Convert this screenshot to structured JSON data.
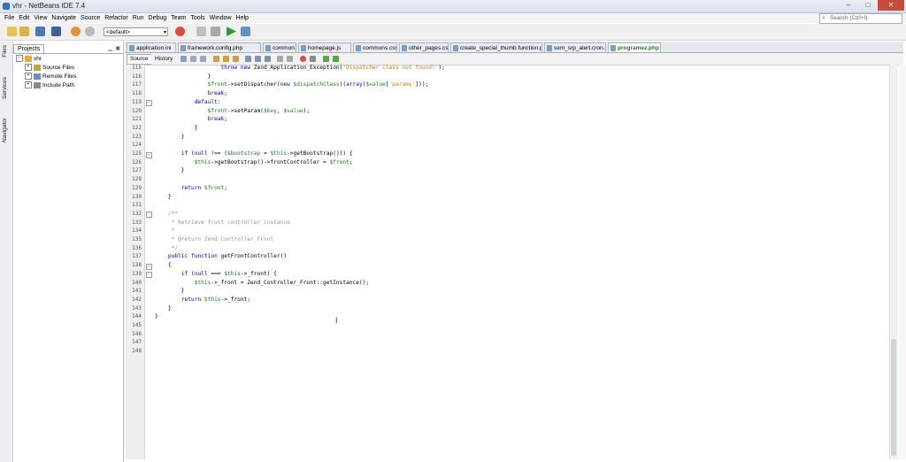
{
  "window": {
    "title": "vhr - NetBeans IDE 7.4",
    "min": "–",
    "max": "□",
    "close": "✕"
  },
  "menu": [
    "File",
    "Edit",
    "View",
    "Navigate",
    "Source",
    "Refactor",
    "Run",
    "Debug",
    "Team",
    "Tools",
    "Window",
    "Help"
  ],
  "search": {
    "placeholder": "Search (Ctrl+I)",
    "icon": "search-icon"
  },
  "toolbar": {
    "config": "<default>"
  },
  "sidebar": {
    "tabs": [
      "Files",
      "Services",
      "Navigator"
    ]
  },
  "projects": {
    "tab": "Projects",
    "tree": [
      {
        "label": "vhr",
        "level": 0,
        "expander": "−"
      },
      {
        "label": "Source Files",
        "level": 1,
        "expander": "+"
      },
      {
        "label": "Remote Files",
        "level": 1,
        "expander": "+"
      },
      {
        "label": "Include Path",
        "level": 1,
        "expander": "+"
      }
    ]
  },
  "editor": {
    "tabs": [
      {
        "label": "application.ini",
        "active": false
      },
      {
        "label": "framework.config.php",
        "active": false
      },
      {
        "label": "common.js",
        "active": false
      },
      {
        "label": "homepage.js",
        "active": false
      },
      {
        "label": "commons.css",
        "active": false
      },
      {
        "label": "other_pages.css",
        "active": false
      },
      {
        "label": "create_special_thumb.function.php",
        "active": false
      },
      {
        "label": "sem_srp_alert.cron.php",
        "active": false
      },
      {
        "label": "programez.php",
        "active": true
      }
    ],
    "source_label": "Source",
    "history_label": "History",
    "lines": [
      {
        "n": 115,
        "text": "                    throw new Zend_Application_Exception('Dispatcher class not found!');",
        "fold": ""
      },
      {
        "n": 116,
        "text": "                }",
        "fold": ""
      },
      {
        "n": 117,
        "text": "                $front->setDispatcher(new $dispatchClass((array)$value['params']));",
        "fold": ""
      },
      {
        "n": 118,
        "text": "                break;",
        "fold": ""
      },
      {
        "n": 119,
        "text": "            default:",
        "fold": "−"
      },
      {
        "n": 120,
        "text": "                $front->setParam($key, $value);",
        "fold": ""
      },
      {
        "n": 121,
        "text": "                break;",
        "fold": ""
      },
      {
        "n": 122,
        "text": "            }",
        "fold": ""
      },
      {
        "n": 123,
        "text": "        }",
        "fold": ""
      },
      {
        "n": 124,
        "text": "",
        "fold": ""
      },
      {
        "n": 125,
        "text": "        if (null !== ($bootstrap = $this->getBootstrap())) {",
        "fold": "−"
      },
      {
        "n": 126,
        "text": "            $this->getBootstrap()->frontController = $front;",
        "fold": ""
      },
      {
        "n": 127,
        "text": "        }",
        "fold": ""
      },
      {
        "n": 128,
        "text": "",
        "fold": ""
      },
      {
        "n": 129,
        "text": "        return $front;",
        "fold": ""
      },
      {
        "n": 130,
        "text": "    }",
        "fold": ""
      },
      {
        "n": 131,
        "text": "",
        "fold": ""
      },
      {
        "n": 132,
        "text": "    /**",
        "fold": "−"
      },
      {
        "n": 133,
        "text": "     * Retrieve front controller instance",
        "fold": ""
      },
      {
        "n": 134,
        "text": "     *",
        "fold": ""
      },
      {
        "n": 135,
        "text": "     * @return Zend_Controller_Front",
        "fold": ""
      },
      {
        "n": 136,
        "text": "     */",
        "fold": ""
      },
      {
        "n": 137,
        "text": "    public function getFrontController()",
        "fold": ""
      },
      {
        "n": 138,
        "text": "    {",
        "fold": "−"
      },
      {
        "n": 139,
        "text": "        if (null === $this->_front) {",
        "fold": "−"
      },
      {
        "n": 140,
        "text": "            $this->_front = Zend_Controller_Front::getInstance();",
        "fold": ""
      },
      {
        "n": 141,
        "text": "        }",
        "fold": ""
      },
      {
        "n": 142,
        "text": "        return $this->_front;",
        "fold": ""
      },
      {
        "n": 143,
        "text": "    }",
        "fold": ""
      },
      {
        "n": 144,
        "text": "}",
        "fold": ""
      },
      {
        "n": 145,
        "text": "",
        "fold": ""
      },
      {
        "n": 146,
        "text": "",
        "fold": ""
      },
      {
        "n": 147,
        "text": "",
        "fold": ""
      },
      {
        "n": 148,
        "text": "",
        "fold": ""
      }
    ]
  },
  "colors": {
    "keyword": "#0000e6",
    "variable": "#1f7a1f",
    "string": "#ce7b00",
    "comment": "#969696",
    "active_tab": "#1a7a1a"
  }
}
